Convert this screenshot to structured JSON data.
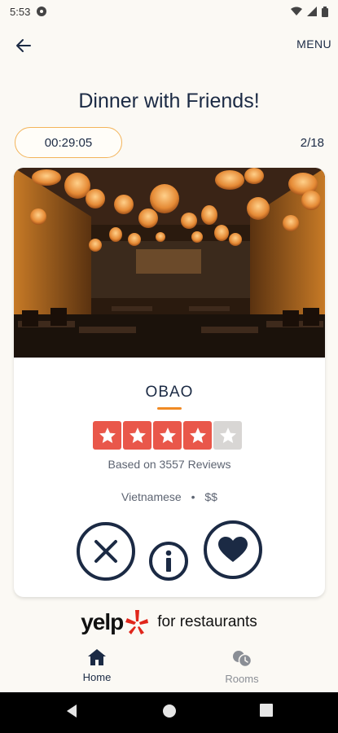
{
  "status_bar": {
    "time": "5:53"
  },
  "app_bar": {
    "menu_label": "MENU"
  },
  "page": {
    "title": "Dinner with Friends!"
  },
  "session": {
    "timer": "00:29:05",
    "counter": "2/18"
  },
  "restaurant": {
    "name": "OBAO",
    "rating": 4,
    "rating_max": 5,
    "reviews_text": "Based on 3557 Reviews",
    "cuisine": "Vietnamese",
    "separator": "•",
    "price": "$$"
  },
  "branding": {
    "yelp_word": "yelp",
    "tagline": "for restaurants"
  },
  "bottom_nav": {
    "items": [
      {
        "label": "Home"
      },
      {
        "label": "Rooms"
      }
    ]
  },
  "colors": {
    "accent": "#f3b45a",
    "navy": "#1b2a44",
    "star_on": "#e9574a",
    "star_off": "#d8d6d4",
    "underline": "#f08a24",
    "yelp_burst": "#e0261b"
  },
  "icons": {
    "back": "arrow-left-icon",
    "reject": "close-icon",
    "info": "info-icon",
    "like": "heart-icon",
    "home": "home-icon",
    "rooms": "rooms-icon"
  }
}
